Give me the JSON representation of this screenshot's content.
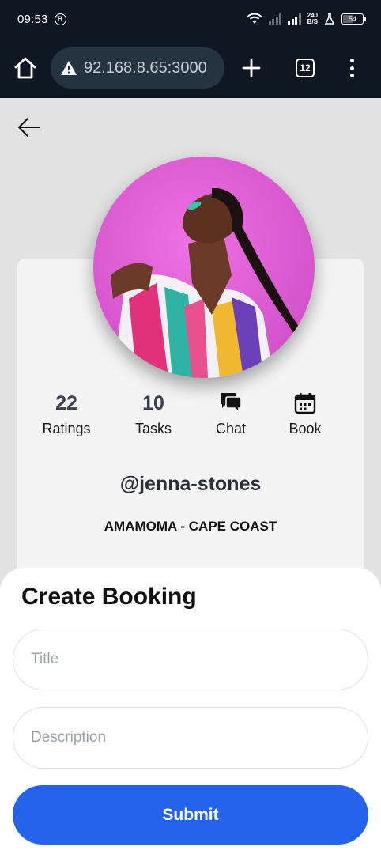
{
  "status_bar": {
    "time": "09:53",
    "notification_badge": "B",
    "net_speed_value": "240",
    "net_speed_unit": "B/S",
    "battery_level": "54"
  },
  "browser": {
    "url": "92.168.8.65:3000",
    "tab_count": "12"
  },
  "profile": {
    "ratings_count": "22",
    "ratings_label": "Ratings",
    "tasks_count": "10",
    "tasks_label": "Tasks",
    "chat_label": "Chat",
    "book_label": "Book",
    "handle": "@jenna-stones",
    "location": "AMAMOMA - CAPE COAST"
  },
  "booking": {
    "heading": "Create Booking",
    "title_placeholder": "Title",
    "description_placeholder": "Description",
    "submit_label": "Submit"
  },
  "colors": {
    "primary": "#2563eb",
    "dark_bar": "#0f1722",
    "url_box": "#263442",
    "avatar_bg": "#e05fd6"
  },
  "icons": [
    "home-icon",
    "warning-icon",
    "plus-icon",
    "tabs-icon",
    "more-icon",
    "back-arrow-icon",
    "chat-icon",
    "calendar-icon"
  ]
}
